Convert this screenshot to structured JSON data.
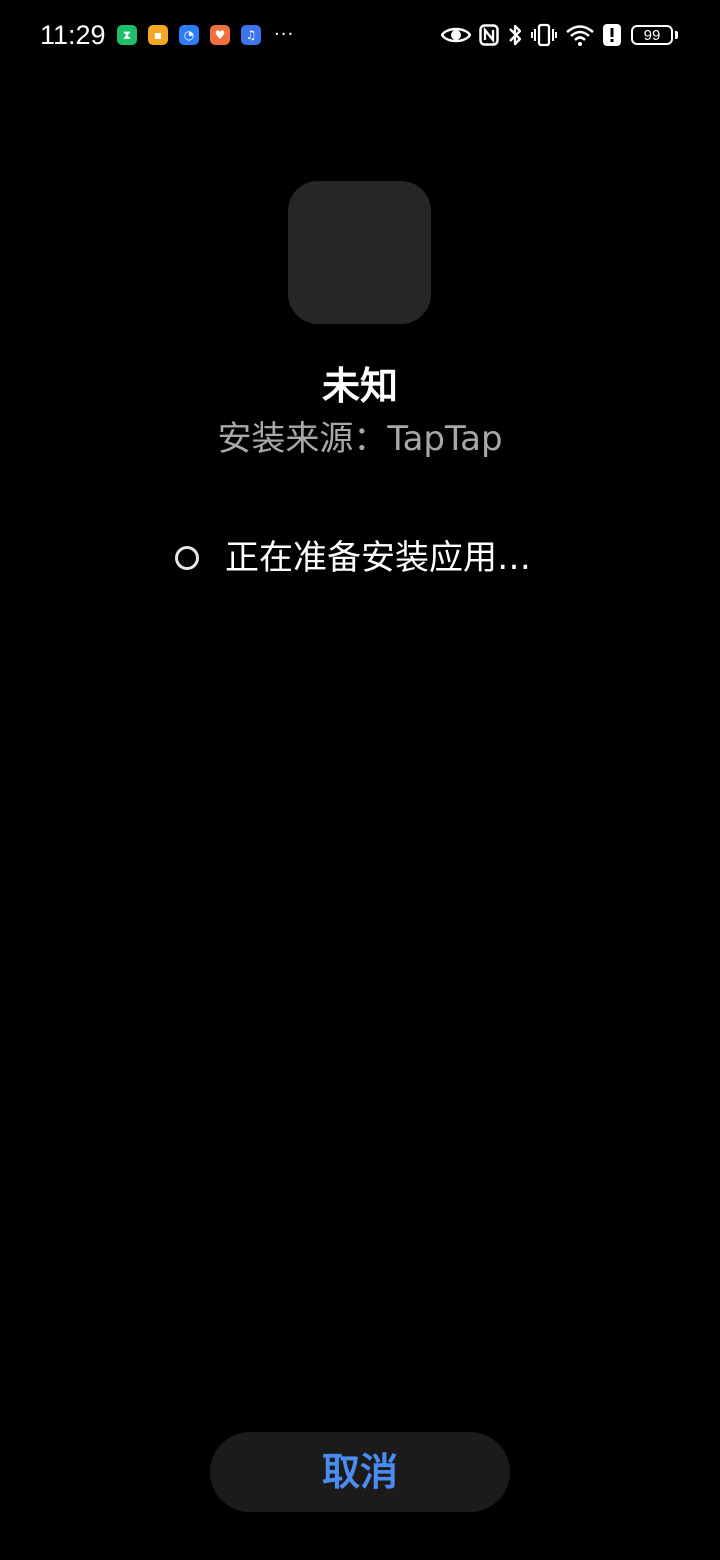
{
  "status_bar": {
    "time": "11:29",
    "notifications": [
      {
        "icon": "hourglass-app-icon",
        "color": "#1fbf6a",
        "glyph": "⧗"
      },
      {
        "icon": "chat-app-icon",
        "color": "#f5a623",
        "glyph": "▪"
      },
      {
        "icon": "support-app-icon",
        "color": "#2f7df6",
        "glyph": "◔"
      },
      {
        "icon": "heart-app-icon",
        "color": "#f0703e",
        "glyph": "♥"
      },
      {
        "icon": "music-app-icon",
        "color": "#3f74f0",
        "glyph": "♫"
      }
    ],
    "more_indicator": "···",
    "system_icons": [
      "eye-icon",
      "nfc-icon",
      "bluetooth-icon",
      "vibrate-icon",
      "wifi-icon",
      "alert-icon"
    ],
    "battery_level": "99"
  },
  "app": {
    "name": "未知",
    "install_source": "安装来源：TapTap"
  },
  "progress": {
    "text": "正在准备安装应用…"
  },
  "actions": {
    "cancel_label": "取消"
  },
  "colors": {
    "background": "#000000",
    "accent": "#4a8cf0",
    "secondary_text": "#a8a8a8",
    "button_bg": "#1b1b1b",
    "icon_placeholder": "#262626"
  }
}
